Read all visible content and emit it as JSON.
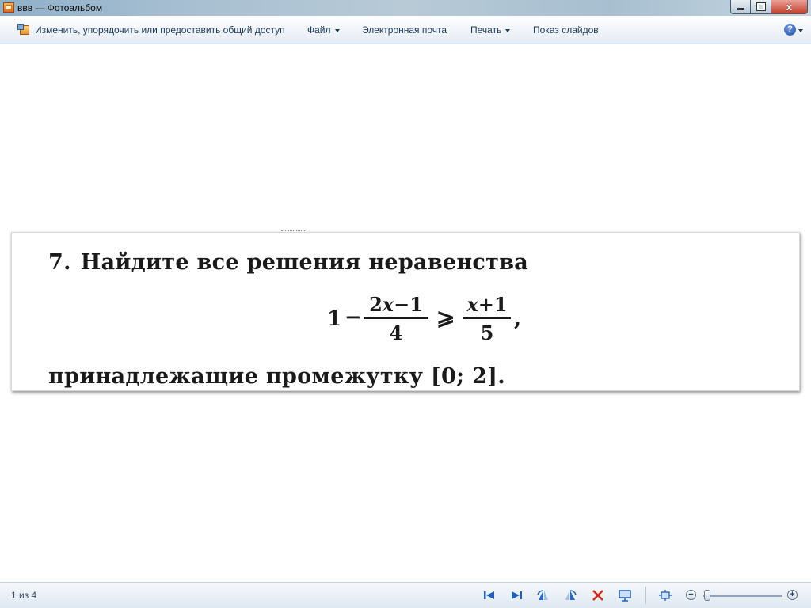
{
  "window": {
    "title": "ввв — Фотоальбом",
    "close_glyph": "x"
  },
  "commandbar": {
    "organize_label": "Изменить, упорядочить или предоставить общий доступ",
    "file_label": "Файл",
    "email_label": "Электронная почта",
    "print_label": "Печать",
    "slideshow_label": "Показ слайдов",
    "help_glyph": "?"
  },
  "photo_content": {
    "task_number": "7.",
    "task_text": "Найдите все решения неравенства",
    "formula": {
      "one": "1",
      "minus": "−",
      "frac1_num_coef": "2",
      "frac1_num_var": "x",
      "frac1_num_rest": "−1",
      "frac1_den": "4",
      "relation": "⩾",
      "frac2_num_var": "x",
      "frac2_num_rest": "+1",
      "frac2_den": "5",
      "comma": ","
    },
    "tail_text": "принадлежащие промежутку [0; 2]."
  },
  "statusbar": {
    "page_counter": "1 из 4",
    "zoom_out_glyph": "−",
    "zoom_in_glyph": "+",
    "zoom_level": 0.05
  },
  "colors": {
    "command_text": "#1e395b",
    "toolbar_blue": "#1f5fb8",
    "delete_red": "#d42a1a"
  }
}
